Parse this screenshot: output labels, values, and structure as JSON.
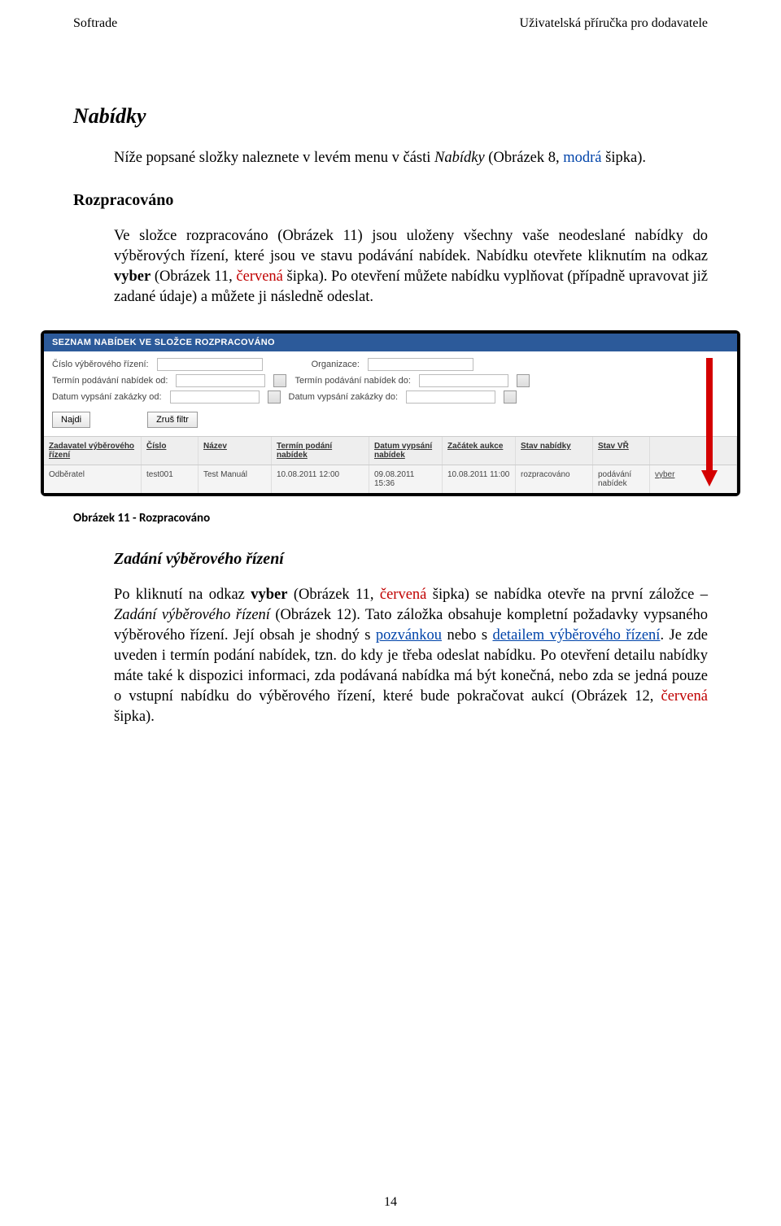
{
  "header": {
    "left": "Softrade",
    "right": "Uživatelská příručka pro dodavatele"
  },
  "section_title": "Nabídky",
  "intro": {
    "pre": "Níže popsané složky naleznete v levém menu v části ",
    "em": "Nabídky",
    "mid": " (Obrázek 8, ",
    "blue": "modrá",
    "post": " šipka)."
  },
  "rozpracovano_title": "Rozpracováno",
  "rozpracovano_body": {
    "p1": "Ve složce rozpracováno (Obrázek 11) jsou uloženy všechny vaše neodeslané nabídky do výběrových řízení, které jsou ve stavu podávání nabídek. Nabídku otevřete kliknutím na odkaz ",
    "b1": "vyber",
    "p2": " (Obrázek 11, ",
    "red": "červená",
    "p3": " šipka). Po otevření můžete nabídku vyplňovat (případně upravovat již zadané údaje) a můžete ji následně odeslat."
  },
  "shot": {
    "title": "SEZNAM NABÍDEK VE SLOŽCE ROZPRACOVÁNO",
    "labels": {
      "cislo": "Číslo výběrového řízení:",
      "organizace": "Organizace:",
      "termin_od": "Termín podávání nabídek od:",
      "termin_do": "Termín podávání nabídek do:",
      "datum_od": "Datum vypsání zakázky od:",
      "datum_do": "Datum vypsání zakázky do:",
      "najdi": "Najdi",
      "zrus": "Zruš filtr"
    },
    "headers": {
      "a": "Zadavatel výběrového řízení",
      "b": "Číslo",
      "c": "Název",
      "d": "Termín podání nabídek",
      "e": "Datum vypsání nabídek",
      "f": "Začátek aukce",
      "g": "Stav nabídky",
      "h": "Stav VŘ",
      "i": ""
    },
    "row": {
      "a": "Odběratel",
      "b": "test001",
      "c": "Test Manuál",
      "d": "10.08.2011 12:00",
      "e": "09.08.2011 15:36",
      "f": "10.08.2011 11:00",
      "g": "rozpracováno",
      "h": "podávání nabídek",
      "i": "vyber"
    }
  },
  "caption": "Obrázek 11 - Rozpracováno",
  "zadani_title": "Zadání výběrového řízení",
  "zadani_body": {
    "s1": "Po kliknutí na odkaz ",
    "b1": "vyber",
    "s2": " (Obrázek 11, ",
    "red1": "červená",
    "s3": " šipka) se nabídka otevře na první záložce – ",
    "em1": "Zadání výběrového řízení",
    "s4": " (Obrázek 12). Tato záložka obsahuje kompletní požadavky vypsaného výběrového řízení. Její obsah je shodný s ",
    "link1": "pozvánkou",
    "s5": " nebo s ",
    "link2": "detailem výběrového řízení",
    "s6": ". Je zde uveden i termín podání nabídek, tzn. do kdy je třeba odeslat nabídku. Po otevření detailu nabídky máte také k dispozici informaci, zda podávaná nabídka má být konečná, nebo zda se jedná pouze o vstupní nabídku do výběrového řízení, které bude pokračovat aukcí (Obrázek 12, ",
    "red2": "červená",
    "s7": " šipka)."
  },
  "page_number": "14"
}
